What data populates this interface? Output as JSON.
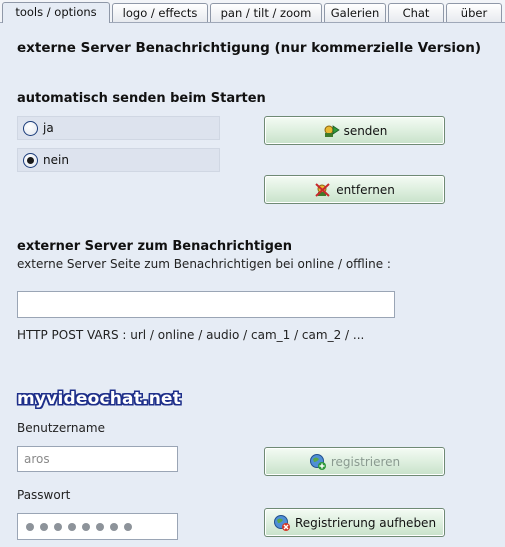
{
  "tabs": [
    {
      "label": "tools / options"
    },
    {
      "label": "logo / effects"
    },
    {
      "label": "pan / tilt / zoom"
    },
    {
      "label": "Galerien"
    },
    {
      "label": "Chat"
    },
    {
      "label": "über"
    }
  ],
  "heading": "externe Server Benachrichtigung (nur kommerzielle Version)",
  "auto_send": {
    "title": "automatisch senden beim Starten",
    "options": [
      {
        "label": "ja",
        "selected": false
      },
      {
        "label": "nein",
        "selected": true
      }
    ],
    "send_button": "senden",
    "remove_button": "entfernen"
  },
  "server": {
    "title": "externer Server zum Benachrichtigen",
    "description": "externe Server Seite zum Benachrichtigen bei online / offline :",
    "url_value": "",
    "post_vars": "HTTP POST VARS : url / online / audio / cam_1 / cam_2 / ..."
  },
  "account": {
    "logo_text": "myvideochat.net",
    "username_label": "Benutzername",
    "username_value": "aros",
    "register_button": "registrieren",
    "password_label": "Passwort",
    "password_mask_count": 8,
    "unregister_button": "Registrierung aufheben"
  },
  "colors": {
    "panel_bg": "#e6ecf5",
    "button_bg": "#dceedd",
    "logo_outline": "#1e2f8a"
  }
}
